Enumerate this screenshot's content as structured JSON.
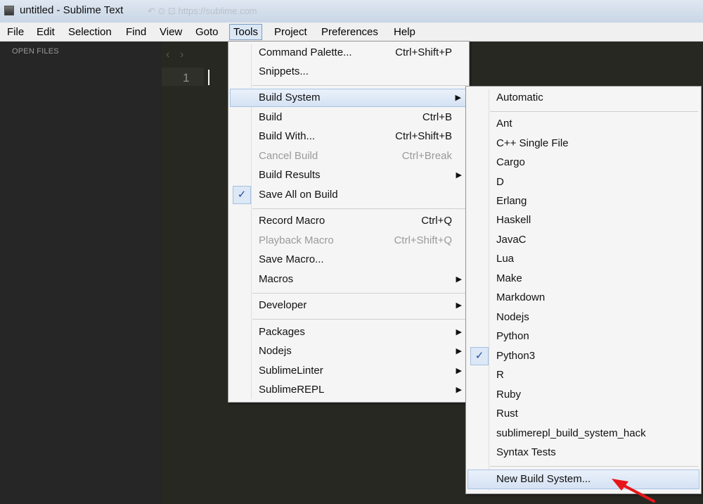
{
  "window": {
    "title": "untitled - Sublime Text",
    "ghost_text": "↶ ⊙  ⊡  https://sublime.com"
  },
  "menubar": [
    "File",
    "Edit",
    "Selection",
    "Find",
    "View",
    "Goto",
    "Tools",
    "Project",
    "Preferences",
    "Help"
  ],
  "sidebar": {
    "label": "OPEN FILES"
  },
  "editor": {
    "nav_back": "‹",
    "nav_forward": "›",
    "line_number": "1"
  },
  "tools_menu": {
    "items": [
      {
        "label": "Command Palette...",
        "shortcut": "Ctrl+Shift+P"
      },
      {
        "label": "Snippets..."
      },
      {
        "label": "Build System",
        "submenu": true,
        "highlighted": true
      },
      {
        "label": "Build",
        "shortcut": "Ctrl+B"
      },
      {
        "label": "Build With...",
        "shortcut": "Ctrl+Shift+B"
      },
      {
        "label": "Cancel Build",
        "shortcut": "Ctrl+Break",
        "disabled": true
      },
      {
        "label": "Build Results",
        "submenu": true
      },
      {
        "label": "Save All on Build",
        "checked": true
      },
      {
        "label": "Record Macro",
        "shortcut": "Ctrl+Q"
      },
      {
        "label": "Playback Macro",
        "shortcut": "Ctrl+Shift+Q",
        "disabled": true
      },
      {
        "label": "Save Macro..."
      },
      {
        "label": "Macros",
        "submenu": true
      },
      {
        "label": "Developer",
        "submenu": true
      },
      {
        "label": "Packages",
        "submenu": true
      },
      {
        "label": "Nodejs",
        "submenu": true
      },
      {
        "label": "SublimeLinter",
        "submenu": true
      },
      {
        "label": "SublimeREPL",
        "submenu": true
      }
    ]
  },
  "build_system_menu": {
    "items": [
      {
        "label": "Automatic"
      },
      {
        "label": "Ant"
      },
      {
        "label": "C++ Single File"
      },
      {
        "label": "Cargo"
      },
      {
        "label": "D"
      },
      {
        "label": "Erlang"
      },
      {
        "label": "Haskell"
      },
      {
        "label": "JavaC"
      },
      {
        "label": "Lua"
      },
      {
        "label": "Make"
      },
      {
        "label": "Markdown"
      },
      {
        "label": "Nodejs"
      },
      {
        "label": "Python"
      },
      {
        "label": "Python3",
        "checked": true
      },
      {
        "label": "R"
      },
      {
        "label": "Ruby"
      },
      {
        "label": "Rust"
      },
      {
        "label": "sublimerepl_build_system_hack"
      },
      {
        "label": "Syntax Tests"
      },
      {
        "label": "New Build System...",
        "highlighted": true
      }
    ]
  },
  "glyphs": {
    "check": "✓",
    "submenu_arrow": "▶"
  },
  "colors": {
    "annotation_arrow": "#e8161b",
    "editor_bg": "#272822",
    "menu_highlight": "#d5e2f3"
  }
}
